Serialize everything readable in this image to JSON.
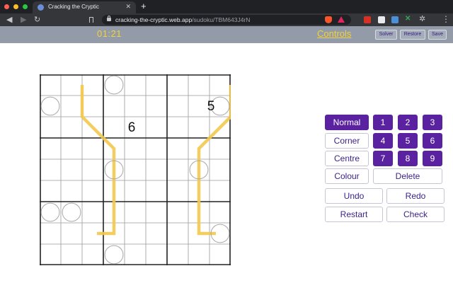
{
  "browser": {
    "tab_title": "Cracking the Cryptic",
    "url_host": "cracking-the-cryptic.web.app",
    "url_path": "/sudoku/TBM643J4rN",
    "icons": {
      "back": "back-arrow-icon",
      "forward": "forward-arrow-icon",
      "reload": "reload-icon",
      "bookmark": "bookmark-icon",
      "lock": "lock-icon",
      "brave": "brave-shield-icon",
      "rewards": "brave-rewards-icon",
      "menu": "menu-dots-icon"
    }
  },
  "header": {
    "timer": "01:21",
    "controls_link": "Controls",
    "solver": "Solver",
    "restore": "Restore",
    "save": "Save"
  },
  "grid": {
    "size": 9,
    "givens": [
      {
        "row": 2,
        "col": 9,
        "value": "5"
      },
      {
        "row": 3,
        "col": 5,
        "value": "6"
      }
    ],
    "circles": [
      [
        1,
        4
      ],
      [
        2,
        1
      ],
      [
        2,
        9
      ],
      [
        5,
        4
      ],
      [
        5,
        8
      ],
      [
        7,
        1
      ],
      [
        7,
        2
      ],
      [
        8,
        9
      ],
      [
        9,
        4
      ]
    ],
    "line_color": "#f2c94c",
    "lines": [
      [
        [
          1,
          2.5
        ],
        [
          2.5,
          2.5
        ],
        [
          4,
          4
        ],
        [
          8,
          4
        ],
        [
          8,
          3.2
        ]
      ],
      [
        [
          1,
          9.5
        ],
        [
          2.5,
          9.5
        ],
        [
          4,
          8
        ],
        [
          8,
          8
        ],
        [
          8,
          8.8
        ]
      ]
    ]
  },
  "controls": {
    "modes": [
      "Normal",
      "Corner",
      "Centre",
      "Colour"
    ],
    "active_mode": "Normal",
    "digits": [
      "1",
      "2",
      "3",
      "4",
      "5",
      "6",
      "7",
      "8",
      "9"
    ],
    "delete": "Delete",
    "undo": "Undo",
    "redo": "Redo",
    "restart": "Restart",
    "check": "Check"
  },
  "colors": {
    "accent": "#5a22a0",
    "header_bg": "#939aa8",
    "timer": "#f2d23c"
  }
}
